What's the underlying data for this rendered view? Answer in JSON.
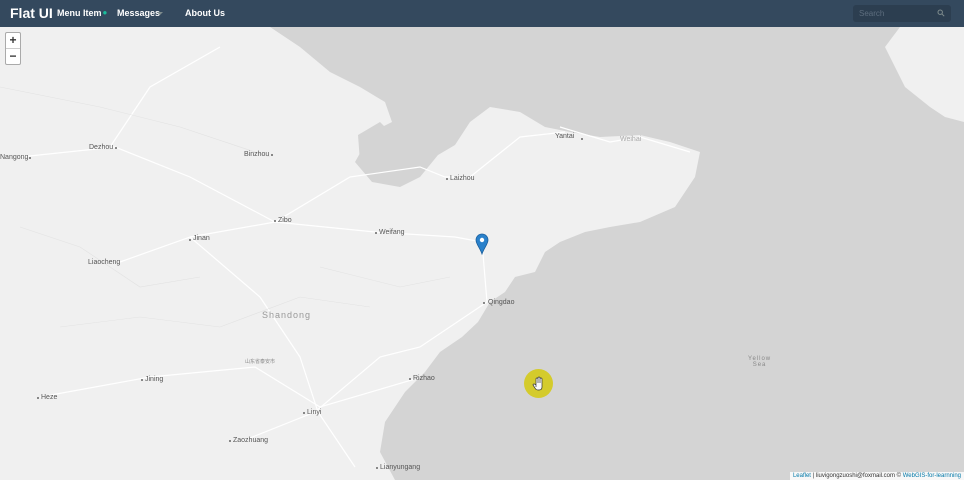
{
  "navbar": {
    "brand": "Flat UI",
    "items": [
      {
        "label": "Menu Item"
      },
      {
        "label": "Messages"
      },
      {
        "label": "About Us"
      }
    ],
    "search_placeholder": "Search"
  },
  "map": {
    "zoom_in": "+",
    "zoom_out": "−",
    "cities": [
      "Yantai",
      "Weihai",
      "Nangong",
      "Dezhou",
      "Binzhou",
      "Laizhou",
      "Zibo",
      "Weifang",
      "Jinan",
      "Liaocheng",
      "Qingdao",
      "Rizhao",
      "Jining",
      "Heze",
      "Linyi",
      "Zaozhuang",
      "Lianyungang"
    ],
    "region_label": "Shandong",
    "cjk_label": "山东省泰安市",
    "sea_label_line1": "Yellow",
    "sea_label_line2": "Sea"
  },
  "attribution": {
    "leaflet": "Leaflet",
    "sep": " | liuvigongzuoshi@foxmail.com © ",
    "webgis": "WebGIS-for-learnning"
  },
  "colors": {
    "navbar": "#34495e",
    "land": "#f0f0f0",
    "sea": "#d4d4d4",
    "marker": "#2a81cb",
    "cursor": "#d4cb1a"
  }
}
